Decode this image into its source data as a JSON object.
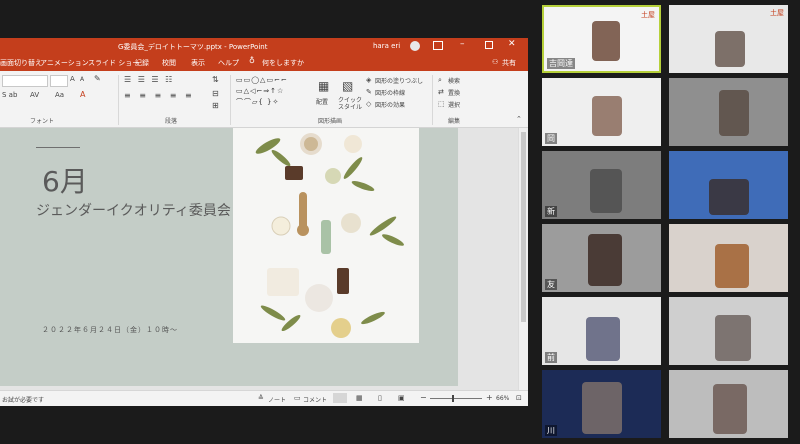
{
  "window": {
    "title": "G委員会_デロイトトーマツ.pptx - PowerPoint",
    "user": "hara eri"
  },
  "menu": {
    "items": [
      "画面切り替え",
      "アニメーション",
      "スライド ショー",
      "記録",
      "校閲",
      "表示",
      "ヘルプ",
      "何をしますか"
    ],
    "share": "共有"
  },
  "ribbon": {
    "groups": {
      "font": "フォント",
      "paragraph": "段落",
      "drawing": "図形描画",
      "editing": "編集"
    },
    "arrange": "配置",
    "quick_styles": "クイック スタイル",
    "shape_fill": "図形の塗りつぶし",
    "shape_outline": "図形の枠線",
    "shape_effects": "図形の効果",
    "find": "検索",
    "replace": "置換",
    "select": "選択"
  },
  "slide": {
    "month": "6月",
    "committee": "ジェンダーイクオリティ委員会",
    "datetime": "２０２２年６月２４日（金）１０時～"
  },
  "statusbar": {
    "left": "お試が必要です",
    "notes": "ノート",
    "comments": "コメント",
    "zoom": "66%"
  },
  "participants": [
    {
      "name": "吉岡達",
      "active": true,
      "bg": "#f4f4f4",
      "logo": "土屋"
    },
    {
      "name": "",
      "active": false,
      "bg": "#e8e8e8",
      "logo": "土屋"
    },
    {
      "name": "岡",
      "active": false,
      "bg": "#efefef",
      "logo": ""
    },
    {
      "name": "",
      "active": false,
      "bg": "#8f8f8f",
      "logo": ""
    },
    {
      "name": "新",
      "active": false,
      "bg": "#7d7d7d",
      "logo": ""
    },
    {
      "name": "",
      "active": false,
      "bg": "#3f6cb8",
      "logo": ""
    },
    {
      "name": "友",
      "active": false,
      "bg": "#9c9c9c",
      "logo": ""
    },
    {
      "name": "",
      "active": false,
      "bg": "#d9d2cc",
      "logo": ""
    },
    {
      "name": "前",
      "active": false,
      "bg": "#e6e6e6",
      "logo": ""
    },
    {
      "name": "",
      "active": false,
      "bg": "#cfcfcf",
      "logo": ""
    },
    {
      "name": "川",
      "active": false,
      "bg": "#1c2b56",
      "logo": ""
    },
    {
      "name": "",
      "active": false,
      "bg": "#bdbdbd",
      "logo": ""
    }
  ]
}
